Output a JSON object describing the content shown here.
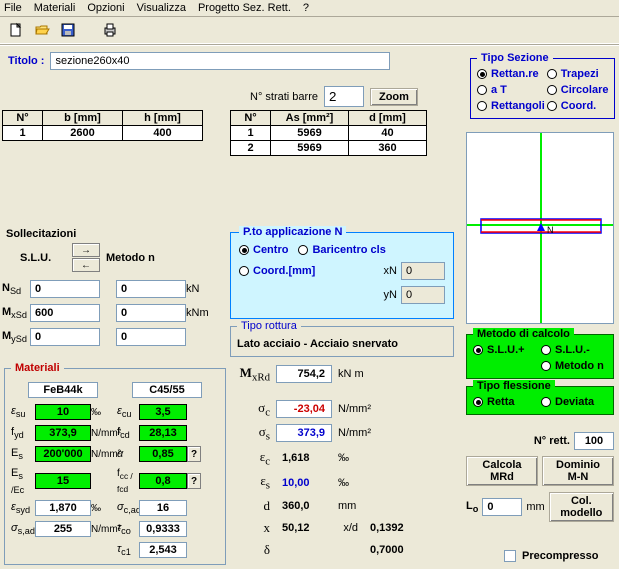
{
  "menu": [
    "File",
    "Materiali",
    "Opzioni",
    "Visualizza",
    "Progetto Sez. Rett.",
    "?"
  ],
  "title": {
    "label": "Titolo :",
    "value": "sezione260x40"
  },
  "tipo_sezione": {
    "legend": "Tipo Sezione",
    "options": [
      "Rettan.re",
      "Trapezi",
      "a T",
      "Circolare",
      "Rettangoli",
      "Coord."
    ],
    "selected_index": 0
  },
  "strati": {
    "label": "N° strati barre",
    "value": "2",
    "zoom": "Zoom"
  },
  "table1": {
    "headers": [
      "N°",
      "b [mm]",
      "h [mm]"
    ],
    "rows": [
      [
        "1",
        "2600",
        "400"
      ]
    ]
  },
  "table2": {
    "headers": [
      "N°",
      "As [mm²]",
      "d [mm]"
    ],
    "rows": [
      [
        "1",
        "5969",
        "40"
      ],
      [
        "2",
        "5969",
        "360"
      ]
    ]
  },
  "solle": {
    "label1": "Sollecitazioni",
    "label2": "S.L.U.",
    "label3": "Metodo n"
  },
  "loads": {
    "NSd_label": "N",
    "NSd_sub": "Sd",
    "NSd": "0",
    "NSd2": "0",
    "NSd_unit": "kN",
    "MxSd_label": "M",
    "MxSd_sub": "xSd",
    "MxSd": "600",
    "MxSd2": "0",
    "MxSd_unit": "kNm",
    "MySd_label": "M",
    "MySd_sub": "ySd",
    "MySd": "0",
    "MySd2": "0"
  },
  "pto": {
    "legend": "P.to applicazione N",
    "opt_centro": "Centro",
    "opt_baric": "Baricentro cls",
    "opt_coord": "Coord.[mm]",
    "xN_label": "xN",
    "xN": "0",
    "yN_label": "yN",
    "yN": "0"
  },
  "rottura": {
    "legend": "Tipo rottura",
    "text": "Lato acciaio - Acciaio snervato"
  },
  "metodo": {
    "legend": "Metodo di calcolo",
    "slu_plus": "S.L.U.+",
    "slu_minus": "S.L.U.-",
    "metodo_n": "Metodo n"
  },
  "tfless": {
    "legend": "Tipo flessione",
    "retta": "Retta",
    "deviata": "Deviata"
  },
  "materiali": {
    "legend": "Materiali",
    "steel": "FeB44k",
    "conc": "C45/55",
    "eps_su_lbl": "ε",
    "eps_su_sub": "su",
    "eps_su": "10",
    "eps_su_unit": "‰",
    "eps_cu_lbl": "ε",
    "eps_cu_sub": "cu",
    "eps_cu": "3,5",
    "fyd_lbl": "f",
    "fyd_sub": "yd",
    "fyd": "373,9",
    "fyd_unit": "N/mm²",
    "fcd_lbl": "f",
    "fcd_sub": "cd",
    "fcd": "28,13",
    "Es_lbl": "E",
    "Es_sub": "s",
    "Es": "200'000",
    "Es_unit": "N/mm²",
    "alpha_lbl": "α",
    "alpha": "0,85",
    "EsEc_lbl": "E",
    "EsEc_sub": "s /Ec",
    "EsEc": "15",
    "fcc_lbl": "f",
    "fcc_sub": "cc / fcd",
    "fcc": "0,8",
    "esyd_lbl": "ε",
    "esyd_sub": "syd",
    "esyd": "1,870",
    "esyd_unit": "‰",
    "scadm_lbl": "σ",
    "scadm_sub": "c,adm",
    "scadm": "16",
    "ssadm_lbl": "σ",
    "ssadm_sub": "s,adm",
    "ssadm": "255",
    "ssadm_unit": "N/mm²",
    "tco_lbl": "τ",
    "tco_sub": "co",
    "tco": "0,9333",
    "tc1_lbl": "τ",
    "tc1_sub": "c1",
    "tc1": "2,543"
  },
  "results": {
    "MxRd_lbl": "M",
    "MxRd_sub": "xRd",
    "MxRd": "754,2",
    "MxRd_unit": "kN m",
    "sigc_lbl": "σ",
    "sigc_sub": "c",
    "sigc": "-23,04",
    "sigc_unit": "N/mm²",
    "sigs_lbl": "σ",
    "sigs_sub": "s",
    "sigs": "373,9",
    "sigs_unit": "N/mm²",
    "epsc_lbl": "ε",
    "epsc_sub": "c",
    "epsc": "1,618",
    "epsc_unit": "‰",
    "epss_lbl": "ε",
    "epss_sub": "s",
    "epss": "10,00",
    "epss_unit": "‰",
    "d_lbl": "d",
    "d": "360,0",
    "d_unit": "mm",
    "x_lbl": "x",
    "x": "50,12",
    "xd_lbl": "x/d",
    "xd": "0,1392",
    "delta_lbl": "δ",
    "delta": "0,7000"
  },
  "right": {
    "nrett_lbl": "N° rett.",
    "nrett": "100",
    "calcola": "Calcola MRd",
    "dominio": "Dominio M-N",
    "Lo_lbl": "L",
    "Lo_sub": "o",
    "Lo": "0",
    "Lo_unit": "mm",
    "colmodel": "Col. modello"
  },
  "precomp": "Precompresso",
  "canvas_label": "N"
}
